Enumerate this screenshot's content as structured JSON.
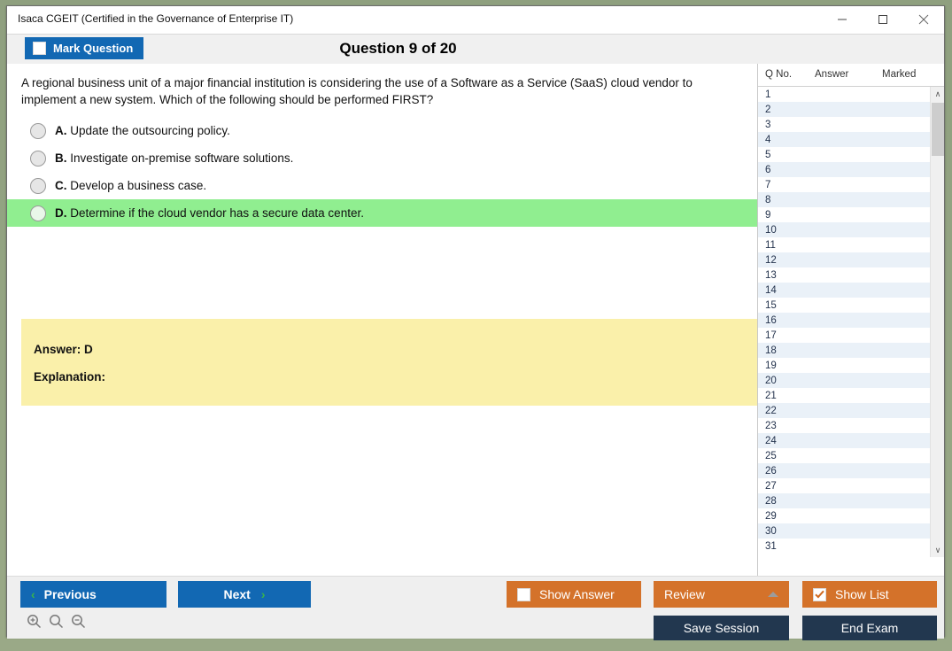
{
  "window": {
    "title": "Isaca CGEIT (Certified in the Governance of Enterprise IT)",
    "minimize_icon": "minimize-icon",
    "maximize_icon": "maximize-icon",
    "close_icon": "close-icon"
  },
  "header": {
    "mark_question_label": "Mark Question",
    "mark_question_checked": false,
    "question_heading": "Question 9 of 20"
  },
  "question": {
    "text": "A regional business unit of a major financial institution is considering the use of a Software as a Service (SaaS) cloud vendor to implement a new system. Which of the following should be performed FIRST?",
    "options": [
      {
        "letter": "A.",
        "text": "Update the outsourcing policy.",
        "highlighted": false,
        "selected": false
      },
      {
        "letter": "B.",
        "text": "Investigate on-premise software solutions.",
        "highlighted": false,
        "selected": false
      },
      {
        "letter": "C.",
        "text": "Develop a business case.",
        "highlighted": false,
        "selected": false
      },
      {
        "letter": "D.",
        "text": "Determine if the cloud vendor has a secure data center.",
        "highlighted": true,
        "selected": false
      }
    ]
  },
  "answer_panel": {
    "answer_line": "Answer: D",
    "explanation_line": "Explanation:"
  },
  "question_list": {
    "columns": [
      "Q No.",
      "Answer",
      "Marked"
    ],
    "rows": [
      {
        "no": "1",
        "answer": "",
        "marked": ""
      },
      {
        "no": "2",
        "answer": "",
        "marked": ""
      },
      {
        "no": "3",
        "answer": "",
        "marked": ""
      },
      {
        "no": "4",
        "answer": "",
        "marked": ""
      },
      {
        "no": "5",
        "answer": "",
        "marked": ""
      },
      {
        "no": "6",
        "answer": "",
        "marked": ""
      },
      {
        "no": "7",
        "answer": "",
        "marked": ""
      },
      {
        "no": "8",
        "answer": "",
        "marked": ""
      },
      {
        "no": "9",
        "answer": "",
        "marked": ""
      },
      {
        "no": "10",
        "answer": "",
        "marked": ""
      },
      {
        "no": "11",
        "answer": "",
        "marked": ""
      },
      {
        "no": "12",
        "answer": "",
        "marked": ""
      },
      {
        "no": "13",
        "answer": "",
        "marked": ""
      },
      {
        "no": "14",
        "answer": "",
        "marked": ""
      },
      {
        "no": "15",
        "answer": "",
        "marked": ""
      },
      {
        "no": "16",
        "answer": "",
        "marked": ""
      },
      {
        "no": "17",
        "answer": "",
        "marked": ""
      },
      {
        "no": "18",
        "answer": "",
        "marked": ""
      },
      {
        "no": "19",
        "answer": "",
        "marked": ""
      },
      {
        "no": "20",
        "answer": "",
        "marked": ""
      },
      {
        "no": "21",
        "answer": "",
        "marked": ""
      },
      {
        "no": "22",
        "answer": "",
        "marked": ""
      },
      {
        "no": "23",
        "answer": "",
        "marked": ""
      },
      {
        "no": "24",
        "answer": "",
        "marked": ""
      },
      {
        "no": "25",
        "answer": "",
        "marked": ""
      },
      {
        "no": "26",
        "answer": "",
        "marked": ""
      },
      {
        "no": "27",
        "answer": "",
        "marked": ""
      },
      {
        "no": "28",
        "answer": "",
        "marked": ""
      },
      {
        "no": "29",
        "answer": "",
        "marked": ""
      },
      {
        "no": "30",
        "answer": "",
        "marked": ""
      },
      {
        "no": "31",
        "answer": "",
        "marked": ""
      }
    ],
    "scroll_up_glyph": "∧",
    "scroll_down_glyph": "∨"
  },
  "footer": {
    "previous_label": "Previous",
    "previous_chevron": "‹",
    "next_label": "Next",
    "next_chevron": "›",
    "show_answer_label": "Show Answer",
    "show_answer_checked": false,
    "review_label": "Review",
    "show_list_label": "Show List",
    "show_list_checked": true,
    "save_session_label": "Save Session",
    "end_exam_label": "End Exam",
    "zoom_in_icon": "zoom-in-icon",
    "zoom_reset_icon": "zoom-icon",
    "zoom_out_icon": "zoom-out-icon"
  },
  "colors": {
    "accent_blue": "#1268b3",
    "accent_orange": "#d4722a",
    "navy": "#22374f",
    "highlight_green": "#90ee90",
    "answer_yellow": "#faf0aa"
  }
}
